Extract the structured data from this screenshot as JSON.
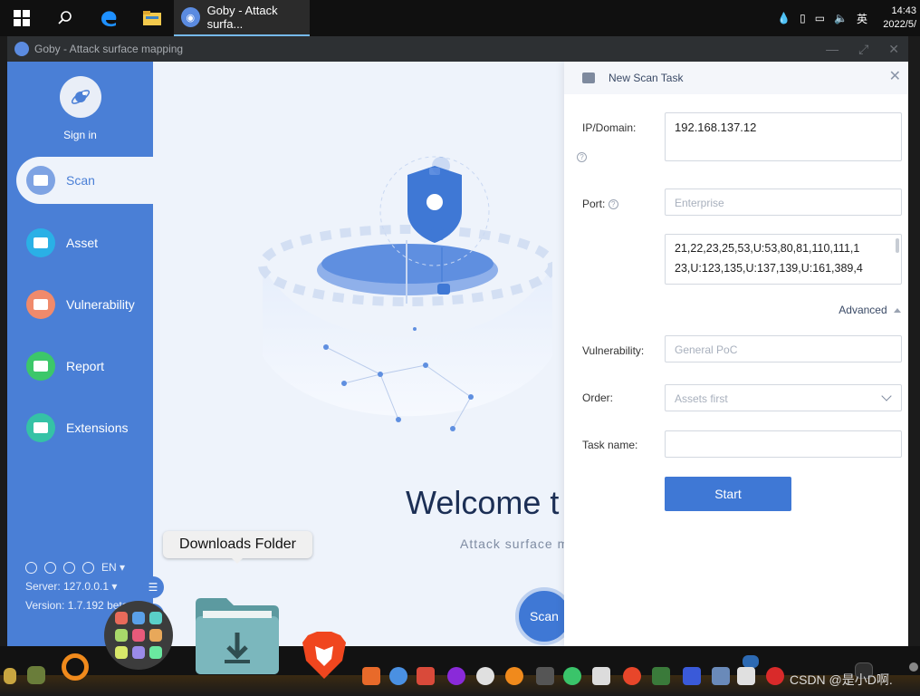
{
  "taskbar": {
    "app_label": "Goby - Attack surfa...",
    "ime": "英",
    "clock_time": "14:43",
    "clock_date": "2022/5/"
  },
  "window": {
    "title": "Goby - Attack surface mapping"
  },
  "sidebar": {
    "signin_label": "Sign in",
    "items": [
      {
        "label": "Scan",
        "icon": "scan-icon",
        "color": "#ffffff"
      },
      {
        "label": "Asset",
        "icon": "asset-icon",
        "color": "#2ab0e6"
      },
      {
        "label": "Vulnerability",
        "icon": "vulnerability-icon",
        "color": "#f08a6b"
      },
      {
        "label": "Report",
        "icon": "report-icon",
        "color": "#3cc76a"
      },
      {
        "label": "Extensions",
        "icon": "extensions-icon",
        "color": "#35c2a6"
      }
    ],
    "language": "EN",
    "server": "Server: 127.0.0.1",
    "version": "Version: 1.7.192 beta"
  },
  "main": {
    "welcome": "Welcome t",
    "subtitle": "Attack surface m",
    "scan_button": "Scan"
  },
  "tooltip": {
    "text": "Downloads Folder"
  },
  "scan_panel": {
    "title": "New Scan Task",
    "ip_label": "IP/Domain:",
    "ip_value": "192.168.137.12",
    "port_label": "Port:",
    "port_preset_placeholder": "Enterprise",
    "ports_line1": "21,22,23,25,53,U:53,80,81,110,111,1",
    "ports_line2": "23,U:123,135,U:137,139,U:161,389,4",
    "advanced_label": "Advanced",
    "vuln_label": "Vulnerability:",
    "vuln_placeholder": "General PoC",
    "order_label": "Order:",
    "order_placeholder": "Assets first",
    "taskname_label": "Task name:",
    "taskname_value": "",
    "start_button": "Start"
  },
  "watermark": "CSDN @是小D啊.",
  "colors": {
    "sidebar": "#4a7fd6",
    "accent": "#3f78d5",
    "panel_bg": "#ffffff",
    "main_bg": "#eef3fb"
  }
}
